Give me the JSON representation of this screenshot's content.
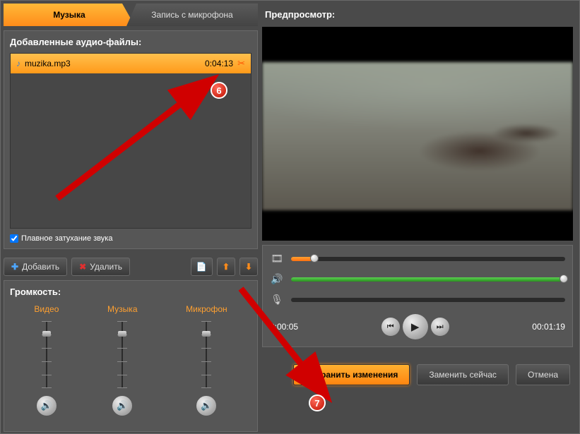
{
  "tabs": {
    "music": "Музыка",
    "mic": "Запись с микрофона"
  },
  "audio": {
    "title": "Добавленные аудио-файлы:",
    "file": {
      "name": "muzika.mp3",
      "duration": "0:04:13"
    },
    "fade_label": "Плавное затухание звука",
    "add": "Добавить",
    "delete": "Удалить"
  },
  "volume": {
    "title": "Громкость:",
    "video": "Видео",
    "music": "Музыка",
    "mic": "Микрофон"
  },
  "preview": {
    "title": "Предпросмотр:"
  },
  "time": {
    "current": "0:00:05",
    "total": "00:01:19"
  },
  "buttons": {
    "save": "Сохранить изменения",
    "replace": "Заменить сейчас",
    "cancel": "Отмена"
  },
  "callouts": {
    "c6": "6",
    "c7": "7"
  }
}
